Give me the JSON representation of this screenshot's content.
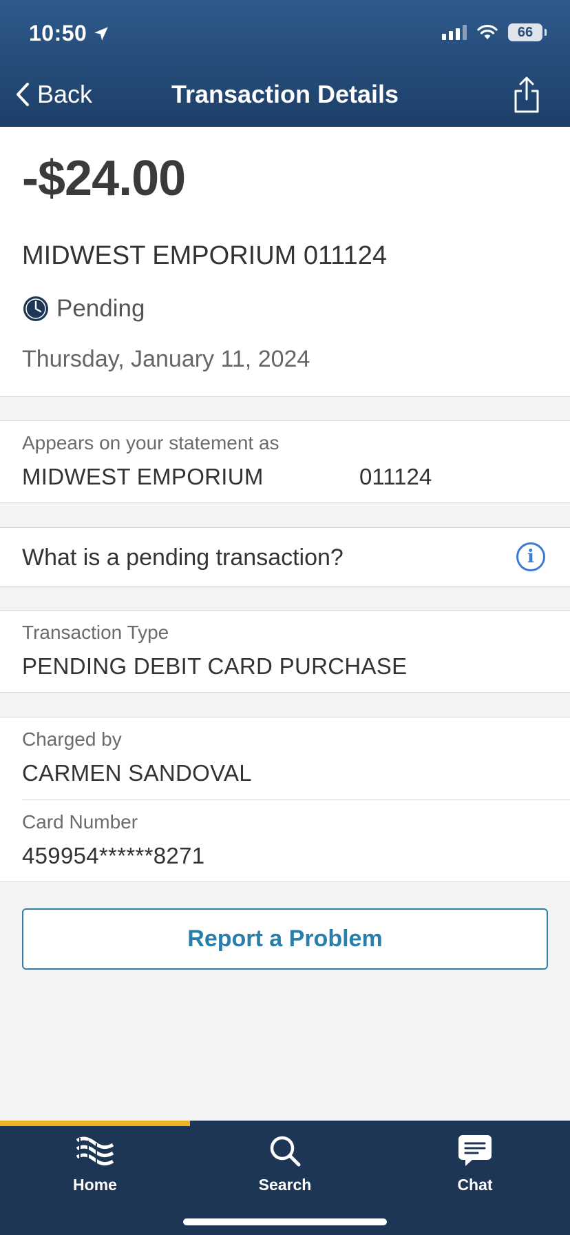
{
  "status_bar": {
    "time": "10:50",
    "battery": "66"
  },
  "header": {
    "back_label": "Back",
    "title": "Transaction Details"
  },
  "summary": {
    "amount": "-$24.00",
    "merchant": "MIDWEST EMPORIUM 011124",
    "status": "Pending",
    "date": "Thursday, January 11, 2024"
  },
  "statement": {
    "label": "Appears on your statement as",
    "name": "MIDWEST EMPORIUM",
    "code": "011124"
  },
  "pending_question": "What is a pending transaction?",
  "transaction_type": {
    "label": "Transaction Type",
    "value": "PENDING DEBIT CARD PURCHASE"
  },
  "charged_by": {
    "label": "Charged by",
    "value": "CARMEN SANDOVAL"
  },
  "card_number": {
    "label": "Card Number",
    "value": "459954******8271"
  },
  "report_button": "Report a Problem",
  "tabs": [
    {
      "label": "Home",
      "icon": "home-logo-icon",
      "active": true
    },
    {
      "label": "Search",
      "icon": "search-icon",
      "active": false
    },
    {
      "label": "Chat",
      "icon": "chat-icon",
      "active": false
    }
  ],
  "colors": {
    "header": "#1d3f68",
    "tabbar": "#1d3656",
    "accent": "#f0b323",
    "link": "#2a7eaa",
    "info": "#3a7bd5"
  }
}
